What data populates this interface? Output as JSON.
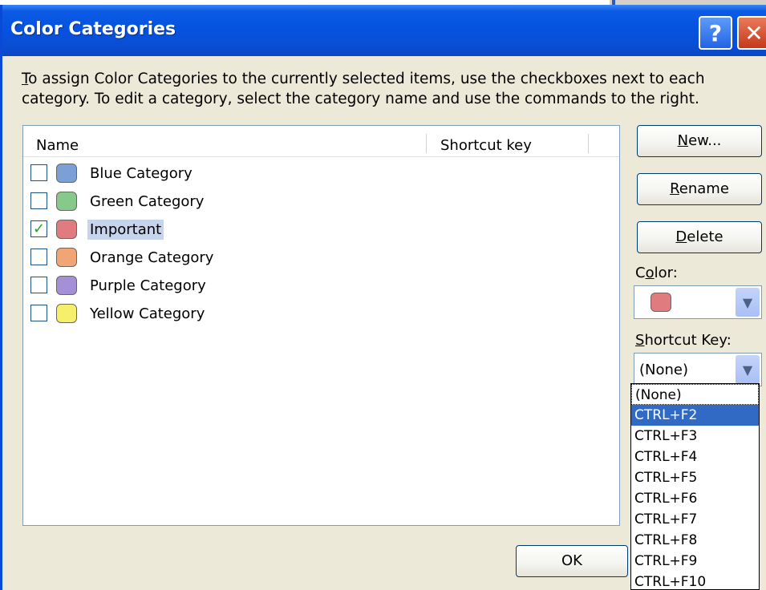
{
  "window": {
    "title": "Color Categories",
    "help_glyph": "?",
    "close_glyph": "✕"
  },
  "description": {
    "line1_prefix": "T",
    "line1_rest": "o assign Color Categories to the currently selected items, use the checkboxes next to each",
    "line2": "category.  To edit a category, select the category name and use the commands to the right."
  },
  "list": {
    "columns": {
      "name": "Name",
      "shortcut": "Shortcut key"
    },
    "items": [
      {
        "label": "Blue Category",
        "checked": false,
        "color": "#7d9fd8",
        "check_glyph": ""
      },
      {
        "label": "Green Category",
        "checked": false,
        "color": "#86c98a",
        "check_glyph": ""
      },
      {
        "label": "Important",
        "checked": true,
        "color": "#e07b80",
        "check_glyph": "✓"
      },
      {
        "label": "Orange Category",
        "checked": false,
        "color": "#f2a574",
        "check_glyph": ""
      },
      {
        "label": "Purple Category",
        "checked": false,
        "color": "#a58fd6",
        "check_glyph": ""
      },
      {
        "label": "Yellow Category",
        "checked": false,
        "color": "#f5ef6a",
        "check_glyph": ""
      }
    ]
  },
  "buttons": {
    "new": {
      "mn": "N",
      "rest": "ew..."
    },
    "rename": {
      "mn": "R",
      "rest": "ename"
    },
    "delete": {
      "mn": "D",
      "rest": "elete"
    },
    "ok": "OK"
  },
  "color": {
    "label_pre": "C",
    "label_mn": "o",
    "label_post": "lor:",
    "selected_color": "#e07b80"
  },
  "shortcut": {
    "label_mn": "S",
    "label_rest": "hortcut Key:",
    "value": "(None)",
    "options": [
      "(None)",
      "CTRL+F2",
      "CTRL+F3",
      "CTRL+F4",
      "CTRL+F5",
      "CTRL+F6",
      "CTRL+F7",
      "CTRL+F8",
      "CTRL+F9",
      "CTRL+F10"
    ],
    "highlighted": "CTRL+F2"
  },
  "arrow_glyph": "▼"
}
